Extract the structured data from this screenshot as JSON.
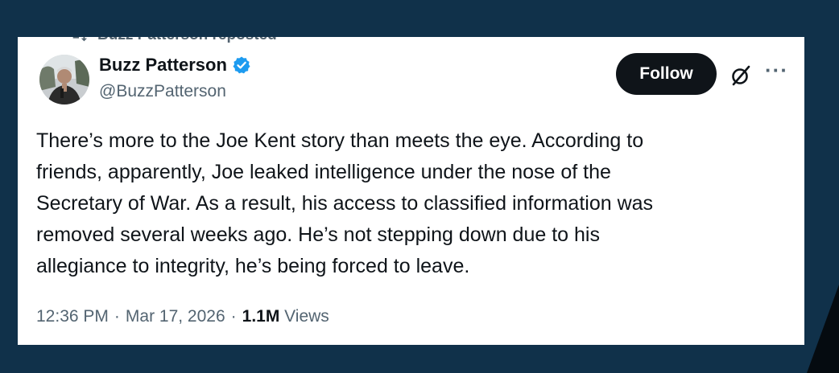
{
  "repost": {
    "label": "Buzz Patterson reposted"
  },
  "author": {
    "name": "Buzz Patterson",
    "handle": "@BuzzPatterson",
    "verified": true,
    "verified_color": "#1d9bf0"
  },
  "actions": {
    "follow_label": "Follow",
    "icons": [
      "grok-icon",
      "more-icon"
    ]
  },
  "tweet": {
    "lines": [
      "There’s more to the Joe Kent story than meets the eye. According to",
      "friends, apparently, Joe leaked intelligence under the nose of the",
      "Secretary of War. As a result, his access to classified information was",
      "removed several weeks ago. He’s not stepping down due to his",
      "allegiance to integrity, he’s being forced to leave."
    ]
  },
  "meta": {
    "time": "12:36 PM",
    "separator": "·",
    "date": "Mar 17, 2026",
    "views_count": "1.1M",
    "views_label": "Views"
  },
  "colors": {
    "background": "#10314a",
    "card": "#ffffff",
    "text": "#0f1419",
    "secondary": "#536471",
    "follow_bg": "#0f1419"
  }
}
